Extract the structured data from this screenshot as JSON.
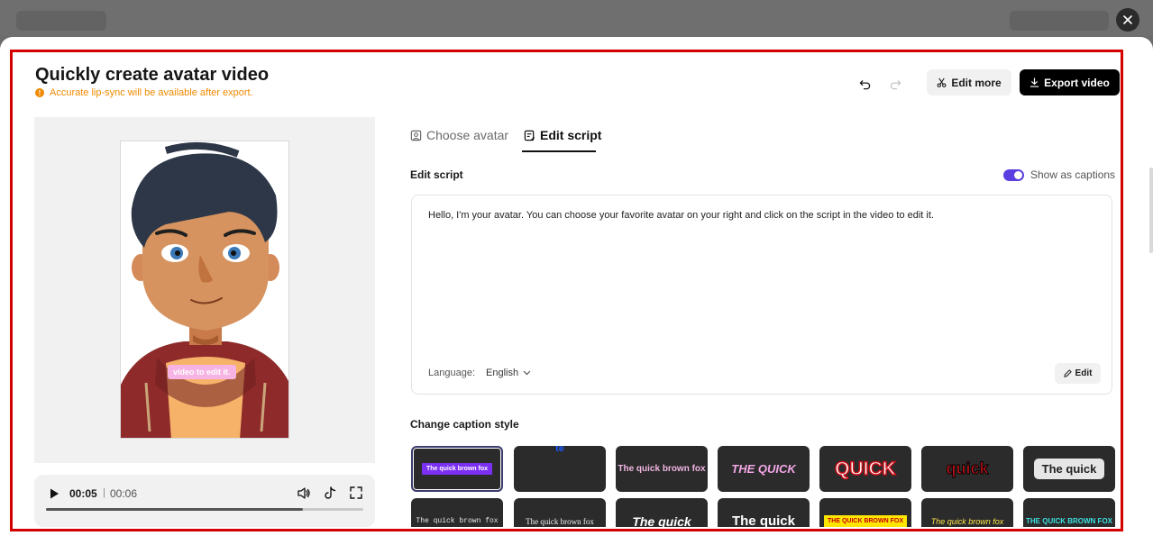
{
  "modal": {
    "title": "Quickly create avatar video",
    "warning": "Accurate lip-sync will be available after export.",
    "warning_icon": "warning-icon",
    "edit_more_label": "Edit more",
    "export_label": "Export video"
  },
  "preview": {
    "caption_overlay": "video to edit it.",
    "time_current": "00:05",
    "time_separator": "|",
    "time_total": "00:06",
    "progress": 0.81
  },
  "tabs": [
    {
      "label": "Choose avatar",
      "icon": "avatar-icon"
    },
    {
      "label": "Edit script",
      "icon": "script-icon",
      "active": true
    }
  ],
  "script": {
    "section_label": "Edit script",
    "show_captions_label": "Show as captions",
    "show_captions_on": true,
    "text": "Hello, I'm your avatar. You can choose your favorite avatar on your right and click on the script in the video to edit it.",
    "language_label": "Language:",
    "language_value": "English",
    "edit_label": "Edit"
  },
  "caption_style": {
    "section_label": "Change caption style",
    "row1": [
      "The quick brown fox",
      "te",
      "The quick brown fox",
      "THE QUICK",
      "QUICK",
      "quick",
      "The quick"
    ],
    "row2": [
      "The quick brown fox",
      "The quick brown fox",
      "The quick",
      "The quick",
      "THE QUICK BROWN FOX",
      "The quick brown fox",
      "THE QUICK BROWN FOX"
    ]
  },
  "colors": {
    "accent": "#5b3fe0",
    "warning": "#ef8a00",
    "frame": "#d40000"
  }
}
